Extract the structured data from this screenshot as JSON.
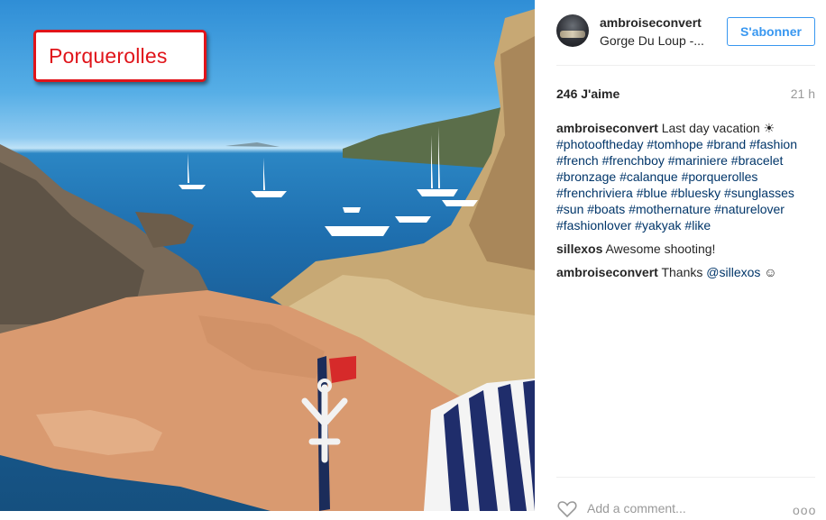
{
  "photo": {
    "label": "Porquerolles"
  },
  "header": {
    "username": "ambroiseconvert",
    "location": "Gorge Du Loup -...",
    "follow_label": "S'abonner"
  },
  "stats": {
    "likes": "246 J'aime",
    "time": "21 h"
  },
  "caption": {
    "user": "ambroiseconvert",
    "text": "Last day vacation ☀",
    "hashtags": [
      "#photooftheday",
      "#tomhope",
      "#brand",
      "#fashion",
      "#french",
      "#frenchboy",
      "#mariniere",
      "#bracelet",
      "#bronzage",
      "#calanque",
      "#porquerolles",
      "#frenchriviera",
      "#blue",
      "#bluesky",
      "#sunglasses",
      "#sun",
      "#boats",
      "#mothernature",
      "#naturelover",
      "#fashionlover",
      "#yakyak",
      "#like"
    ]
  },
  "comments": [
    {
      "user": "sillexos",
      "text": "Awesome shooting!"
    },
    {
      "user": "ambroiseconvert",
      "text": "Thanks",
      "mention": "@sillexos",
      "emoji": "☺"
    }
  ],
  "footer": {
    "add_comment_placeholder": "Add a comment...",
    "more": "ooo"
  }
}
